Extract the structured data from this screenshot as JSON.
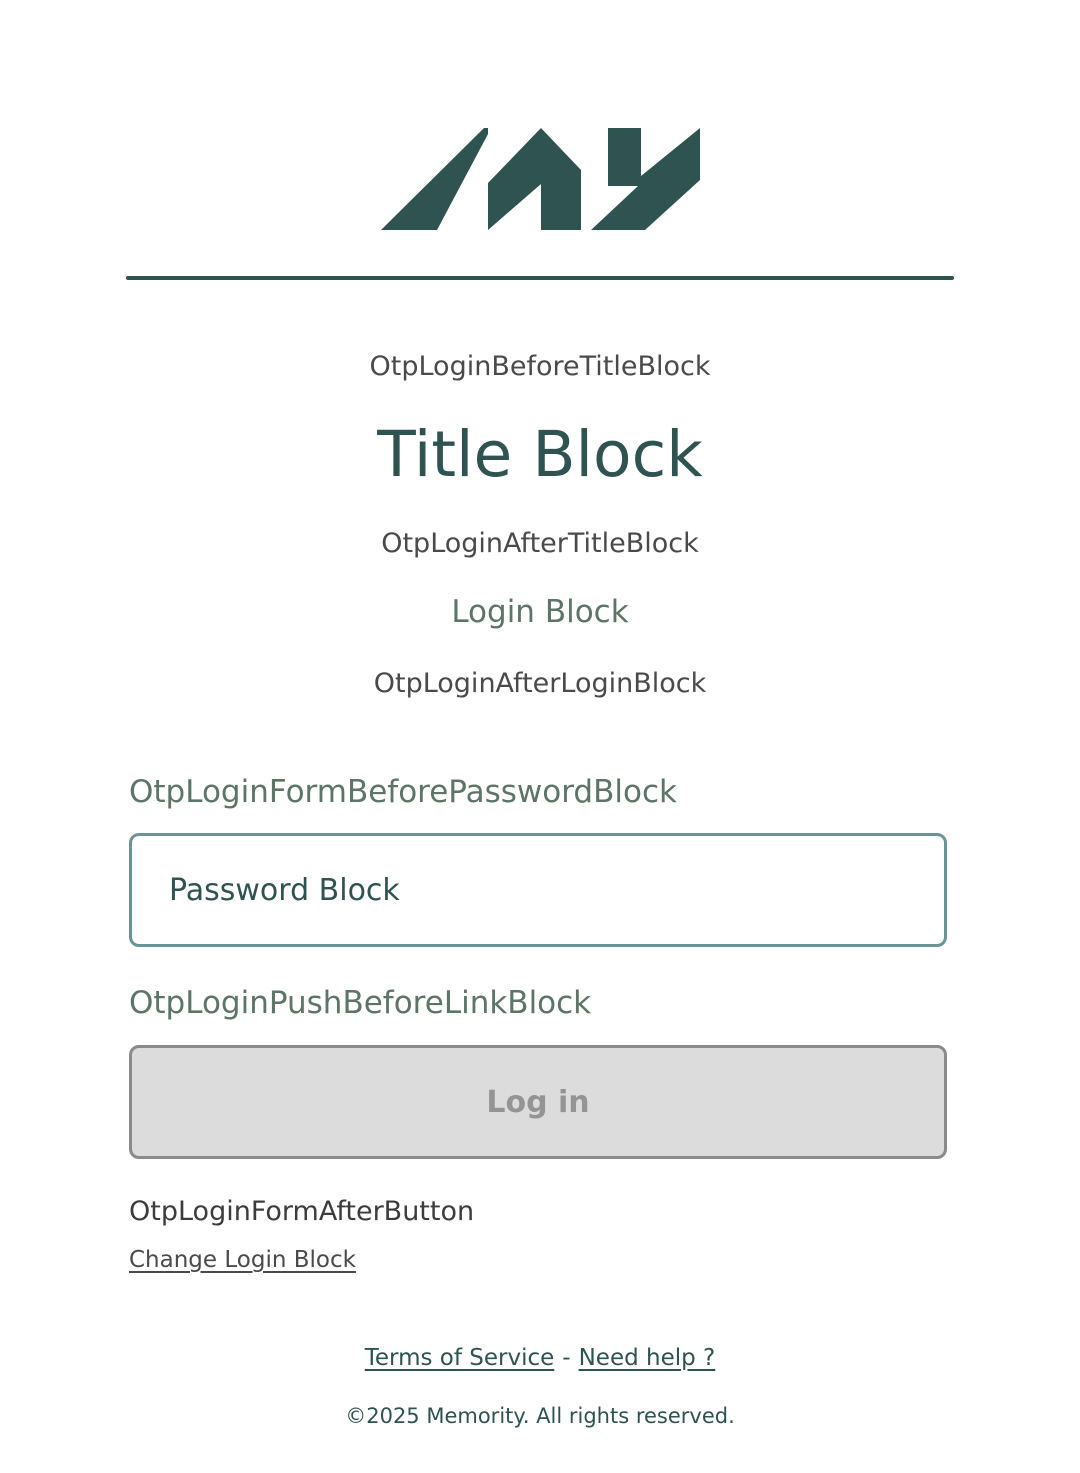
{
  "brand": {
    "logo_color": "#2f5351"
  },
  "header": {
    "before_title": "OtpLoginBeforeTitleBlock",
    "title": "Title Block",
    "after_title": "OtpLoginAfterTitleBlock",
    "login_block": "Login Block",
    "after_login": "OtpLoginAfterLoginBlock"
  },
  "form": {
    "before_password": "OtpLoginFormBeforePasswordBlock",
    "password_value": "Password Block",
    "push_before_link": "OtpLoginPushBeforeLinkBlock",
    "login_button_label": "Log in",
    "after_button": "OtpLoginFormAfterButton",
    "change_login_link": "Change Login Block"
  },
  "footer": {
    "terms_link": "Terms of Service",
    "separator": "-",
    "help_link": "Need help ?",
    "copyright": "©2025 Memority. All rights reserved."
  },
  "colors": {
    "accent": "#2f5351",
    "secondary_text": "#5d7566",
    "input_border": "#6a939a",
    "button_disabled_bg": "#dcdcdc",
    "button_disabled_border": "#8a8a8a"
  }
}
